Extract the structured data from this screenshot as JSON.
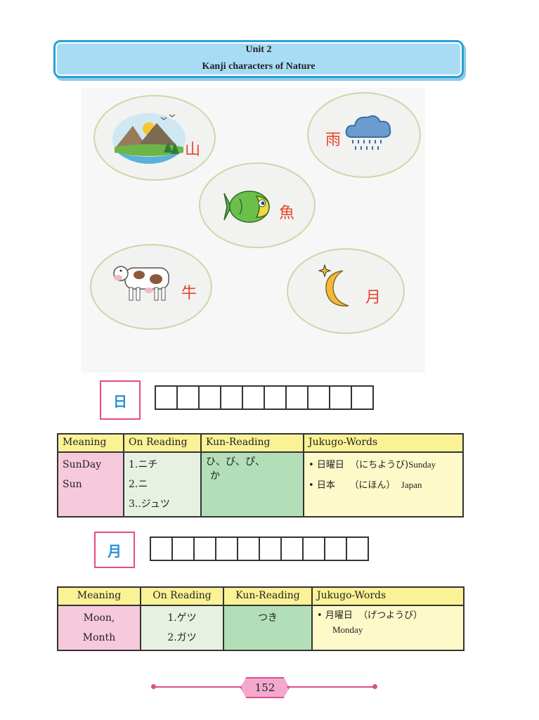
{
  "header": {
    "unit": "Unit 2",
    "title": "Kanji characters of Nature"
  },
  "illustration": {
    "mountain": {
      "kanji": "山",
      "icon": "mountain-landscape-icon"
    },
    "rain": {
      "kanji": "雨",
      "icon": "rain-cloud-icon"
    },
    "fish": {
      "kanji": "魚",
      "icon": "fish-icon"
    },
    "cow": {
      "kanji": "牛",
      "icon": "cow-icon"
    },
    "moon": {
      "kanji": "月",
      "icon": "crescent-moon-icon"
    }
  },
  "sections": [
    {
      "kanji": "日",
      "practice_boxes": 10,
      "headers": [
        "Meaning",
        "On Reading",
        "Kun-Reading",
        "Jukugo-Words"
      ],
      "meaning": [
        "SunDay",
        "Sun"
      ],
      "on": [
        "1.ニチ",
        "2.ニ",
        "3..ジュツ"
      ],
      "kun": [
        "ひ、び、ぴ、",
        "か"
      ],
      "jukugo": [
        {
          "word": "日曜日",
          "reading": "（にちようび)",
          "meaning": "Sunday"
        },
        {
          "word": "日本",
          "reading": "（にほん）",
          "meaning": "Japan"
        }
      ]
    },
    {
      "kanji": "月",
      "practice_boxes": 10,
      "headers": [
        "Meaning",
        "On Reading",
        "Kun-Reading",
        "Jukugo-Words"
      ],
      "meaning": [
        "Moon,",
        "Month"
      ],
      "on": [
        "1.ゲツ",
        "2.ガツ"
      ],
      "kun": [
        "つき"
      ],
      "jukugo": [
        {
          "word": "月曜日",
          "reading": "（げつようび）",
          "meaning": "Monday"
        }
      ]
    }
  ],
  "footer": {
    "page_number": "152"
  },
  "colors": {
    "accent_blue": "#2b9fd8",
    "banner_fill": "#a8dcf5",
    "kanji_red": "#e4452b",
    "pink_border": "#e54c86"
  }
}
